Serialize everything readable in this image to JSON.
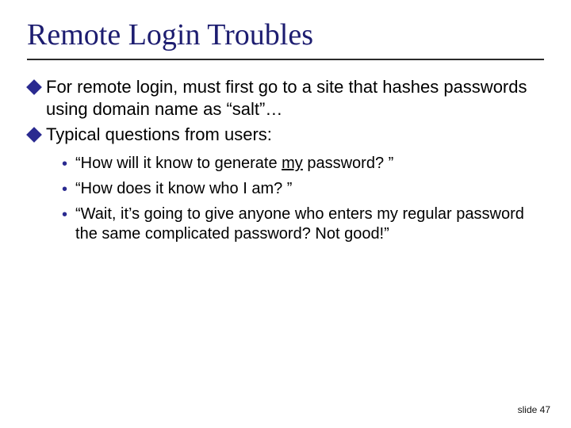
{
  "title": "Remote Login Troubles",
  "bullets": [
    {
      "text": "For remote login, must first go to a site that hashes passwords using domain name as “salt”…"
    },
    {
      "text": "Typical questions from users:"
    }
  ],
  "subbullets": [
    {
      "pre": "“How will it know to generate ",
      "u": "my",
      "post": " password? ”"
    },
    {
      "text": "“How does it know who I am? ”"
    },
    {
      "text": "“Wait, it’s going to give anyone who enters my regular password the same complicated password? Not good!”"
    }
  ],
  "footer": {
    "label": "slide",
    "num": "47"
  }
}
